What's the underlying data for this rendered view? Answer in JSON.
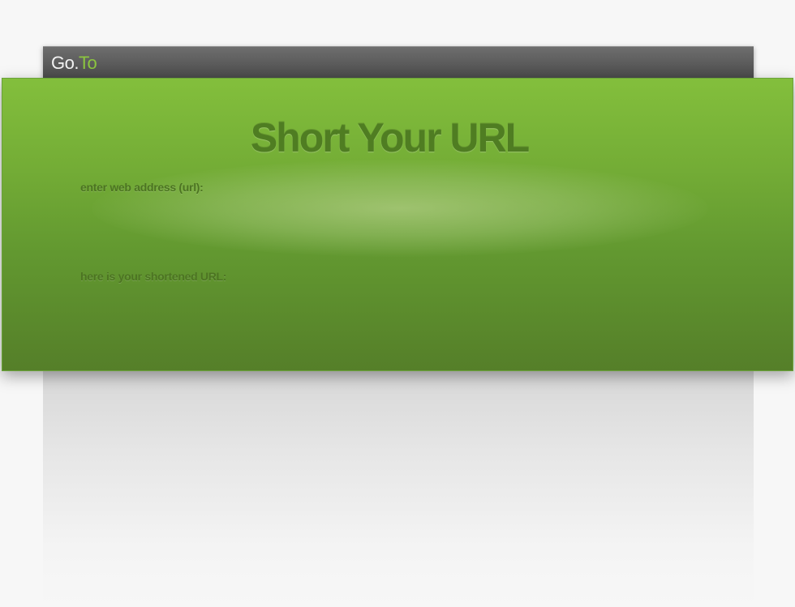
{
  "header": {
    "logo_part1": "Go.",
    "logo_part2": "To"
  },
  "main": {
    "title": "Short Your URL",
    "url_label": "enter web address (url):",
    "url_value": "",
    "short_label": "here is your shortened URL:",
    "short_value": ""
  },
  "colors": {
    "accent": "#8cc63f",
    "panel_green": "#74ad36",
    "title_green": "#4f7d22",
    "header_gray": "#5a5a5a"
  }
}
